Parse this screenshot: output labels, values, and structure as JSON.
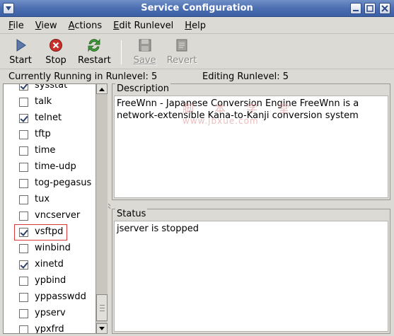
{
  "window": {
    "title": "Service Configuration"
  },
  "menubar": [
    {
      "accel": "F",
      "rest": "ile"
    },
    {
      "accel": "V",
      "rest": "iew"
    },
    {
      "accel": "A",
      "rest": "ctions"
    },
    {
      "accel": "E",
      "rest": "dit Runlevel"
    },
    {
      "accel": "H",
      "rest": "elp"
    }
  ],
  "toolbar": {
    "start_label": "Start",
    "stop_label": "Stop",
    "restart_label": "Restart",
    "save_label": "Save",
    "revert_label": "Revert"
  },
  "status": {
    "running": "Currently Running in Runlevel: 5",
    "editing": "Editing Runlevel: 5"
  },
  "services": [
    {
      "name": "sysstat",
      "checked": true
    },
    {
      "name": "talk",
      "checked": false
    },
    {
      "name": "telnet",
      "checked": true
    },
    {
      "name": "tftp",
      "checked": false
    },
    {
      "name": "time",
      "checked": false
    },
    {
      "name": "time-udp",
      "checked": false
    },
    {
      "name": "tog-pegasus",
      "checked": false
    },
    {
      "name": "tux",
      "checked": false
    },
    {
      "name": "vncserver",
      "checked": false
    },
    {
      "name": "vsftpd",
      "checked": true,
      "highlight": true
    },
    {
      "name": "winbind",
      "checked": false
    },
    {
      "name": "xinetd",
      "checked": true
    },
    {
      "name": "ypbind",
      "checked": false
    },
    {
      "name": "yppasswdd",
      "checked": false
    },
    {
      "name": "ypserv",
      "checked": false
    },
    {
      "name": "ypxfrd",
      "checked": false
    }
  ],
  "description": {
    "label": "Description",
    "text": "FreeWnn - Japanese Conversion Engine FreeWnn is a network-extensible Kana-to-Kanji conversion system"
  },
  "status_frame": {
    "label": "Status",
    "text": "jserver is stopped"
  },
  "watermark": {
    "line1": "脚 本 学 堂",
    "line2": "www.jbxue.com"
  },
  "colors": {
    "titlebar": "#4a6cb0",
    "highlight_border": "#d63a3a",
    "check": "#2b3f69"
  }
}
